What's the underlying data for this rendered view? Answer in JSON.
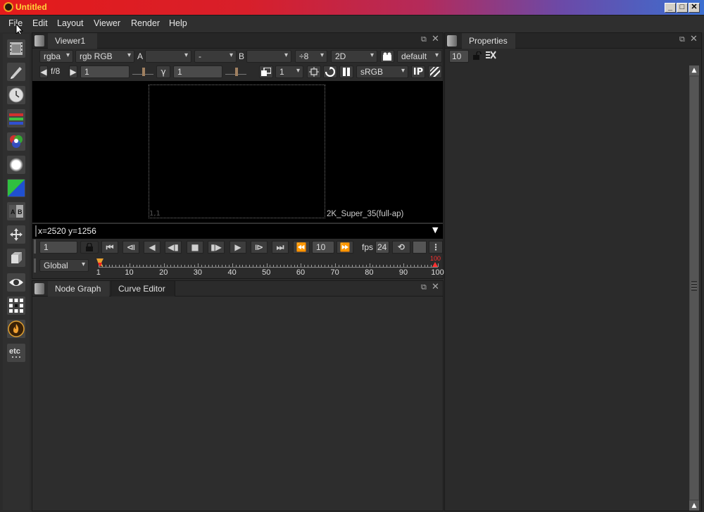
{
  "window": {
    "title": "Untitled",
    "controls": {
      "minimize": "_",
      "maximize": "□",
      "close": "✕"
    }
  },
  "menu": [
    "File",
    "Edit",
    "Layout",
    "Viewer",
    "Render",
    "Help"
  ],
  "toolbar": [
    {
      "name": "image-tool",
      "icon": "film-frame-icon"
    },
    {
      "name": "draw-tool",
      "icon": "pencil-icon"
    },
    {
      "name": "time-tool",
      "icon": "clock-icon"
    },
    {
      "name": "channel-tool",
      "icon": "rgb-bars-icon"
    },
    {
      "name": "color-tool",
      "icon": "color-wheel-icon"
    },
    {
      "name": "filter-tool",
      "icon": "blur-circle-icon"
    },
    {
      "name": "keyer-tool",
      "icon": "keyer-icon"
    },
    {
      "name": "merge-tool",
      "icon": "ab-merge-icon"
    },
    {
      "name": "transform-tool",
      "icon": "move-arrows-icon"
    },
    {
      "name": "3d-tool",
      "icon": "cube-icon"
    },
    {
      "name": "views-tool",
      "icon": "eye-icon"
    },
    {
      "name": "metadata-tool",
      "icon": "grid-icon"
    },
    {
      "name": "other-tool",
      "icon": "flame-icon"
    },
    {
      "name": "etc-tool",
      "icon": "etc-icon",
      "label": "etc"
    }
  ],
  "viewer": {
    "tab": "Viewer1",
    "channels": "rgba",
    "layer": "rgb RGB",
    "input_a_label": "A",
    "input_a": "",
    "composite": "-",
    "input_b_label": "B",
    "input_b": "",
    "downscale": "÷8",
    "view_mode": "2D",
    "lut_default": "default",
    "fstop": "f/8",
    "gain": "1",
    "gamma_label": "γ",
    "gamma": "1",
    "proxy": "1",
    "colorspace": "sRGB",
    "ip_label": "IP",
    "format_label": "2K_Super_35(full-ap)",
    "origin_label": "1,1",
    "coords": "x=2520 y=1256"
  },
  "playback": {
    "frame": "1",
    "step": "10",
    "fps_label": "fps",
    "fps": "24",
    "range_mode": "Global",
    "start": 1,
    "end": 100,
    "end_marker": "100",
    "ticks": [
      "1",
      "10",
      "20",
      "30",
      "40",
      "50",
      "60",
      "70",
      "80",
      "90",
      "100"
    ]
  },
  "nodegraph": {
    "tabs": [
      "Node Graph",
      "Curve Editor"
    ]
  },
  "properties": {
    "tab": "Properties",
    "max_panels": "10"
  },
  "colors": {
    "accent_red": "#e41b1b",
    "timeline_marker": "#ff3030",
    "background": "#2b2b2b"
  }
}
